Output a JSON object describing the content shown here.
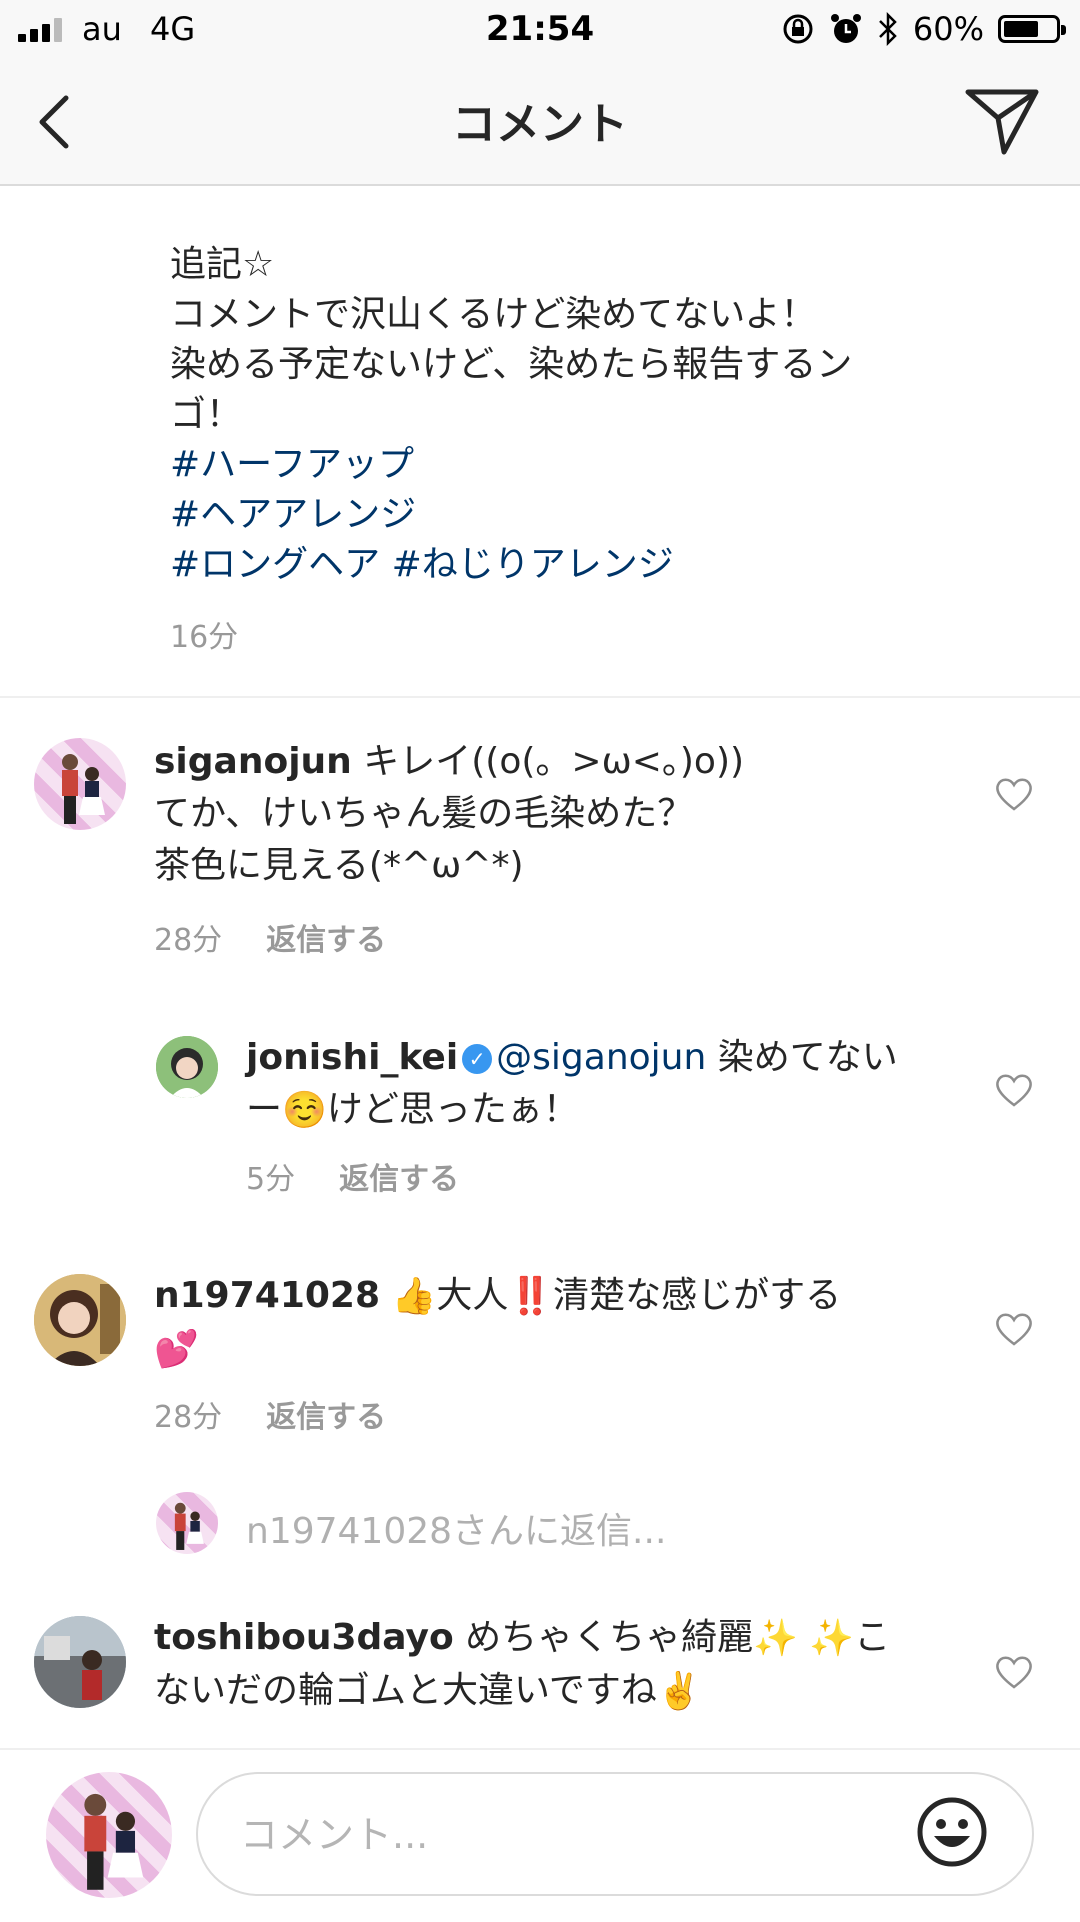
{
  "status_bar": {
    "carrier": "au",
    "network": "4G",
    "time": "21:54",
    "battery_percent": "60%",
    "battery_level": 0.6,
    "icons": [
      "orientation-lock-icon",
      "alarm-icon",
      "bluetooth-icon"
    ]
  },
  "nav": {
    "title": "コメント",
    "back_icon": "chevron-left-icon",
    "send_icon": "direct-send-icon"
  },
  "caption": {
    "lines": [
      "追記☆",
      "コメントで沢山くるけど染めてないよ！",
      "染める予定ないけど、染めたら報告するン",
      "ゴ！"
    ],
    "hashtags": [
      "#ハーフアップ",
      "#ヘアアレンジ",
      "#ロングヘア",
      "#ねじりアレンジ"
    ],
    "time": "16分"
  },
  "comments": [
    {
      "username": "siganojun",
      "text_1": " キレイ((o(。>ω<。)o))",
      "text_2": "てか、けいちゃん髪の毛染めた？",
      "text_3": "茶色に見える(*^ω^*)",
      "time": "28分",
      "reply": "返信する"
    },
    {
      "username": "jonishi_kei",
      "verified": true,
      "mention": "@siganojun",
      "text_1": " 染めてない",
      "text_2a": "ー",
      "text_2b": "けど思ったぁ！",
      "emoji": "☺️",
      "time": "5分",
      "reply": "返信する"
    },
    {
      "username": "n19741028",
      "emoji_1": "👍",
      "text_1": "大人",
      "emoji_2": "‼️",
      "text_2": "清楚な感じがする",
      "emoji_3": "💕",
      "time": "28分",
      "reply": "返信する"
    },
    {
      "username": "toshibou3dayo",
      "text_1": " めちゃくちゃ綺麗",
      "emoji_1": "✨",
      "emoji_2": "✨",
      "text_1b": "こ",
      "text_2": "ないだの輪ゴムと大違いですね",
      "emoji_3": "✌️"
    }
  ],
  "reply_prompt": "n19741028さんに返信...",
  "input": {
    "placeholder": "コメント..."
  },
  "colors": {
    "link": "#003569",
    "secondary_text": "#999999",
    "verified": "#3897f0"
  }
}
